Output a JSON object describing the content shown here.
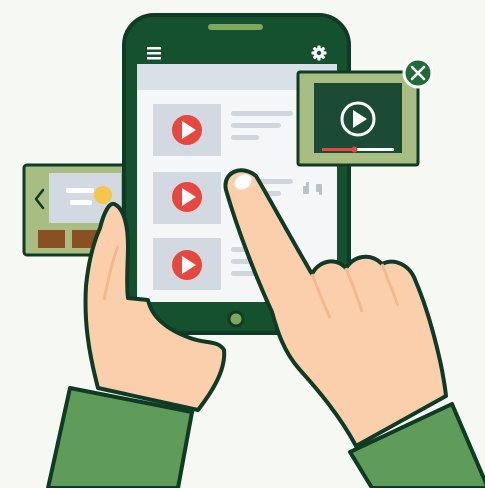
{
  "colors": {
    "background": "#f6f8f3",
    "outline": "#0f3a24",
    "phone_body": "#15502f",
    "header_green": "#1f7a3c",
    "screen": "#f4f6f8",
    "search_bar": "#d9e0e7",
    "thumb_bg": "#d3d9e0",
    "play_red": "#e8473e",
    "line_gray": "#cfd6dd",
    "frame_olive": "#a8bd82",
    "video_dark": "#1b4b34",
    "progress_red": "#e8473e",
    "close_green": "#1f6b3a",
    "skin": "#fccfac",
    "skin_shadow": "#f0b98f",
    "sleeve": "#5f9c5a",
    "sleeve_dark": "#4c8449",
    "brown_tile": "#8a4f22",
    "sun": "#f4c64a",
    "home_button": "#7fa75a"
  },
  "phone": {
    "menu_icon": "hamburger-menu-icon",
    "settings_icon": "gear-icon",
    "video_list": [
      {
        "thumb_icon": "play-icon",
        "lines": 3
      },
      {
        "thumb_icon": "play-icon",
        "lines": 3,
        "reactions": [
          "thumbs-up-icon",
          "thumbs-down-icon"
        ]
      },
      {
        "thumb_icon": "play-icon",
        "lines": 3
      }
    ]
  },
  "popup_player": {
    "play_icon": "play-circle-icon",
    "close_icon": "close-icon",
    "progress": 0.45
  },
  "side_card": {
    "nav_icon": "chevron-left-icon",
    "tiles": 2
  }
}
